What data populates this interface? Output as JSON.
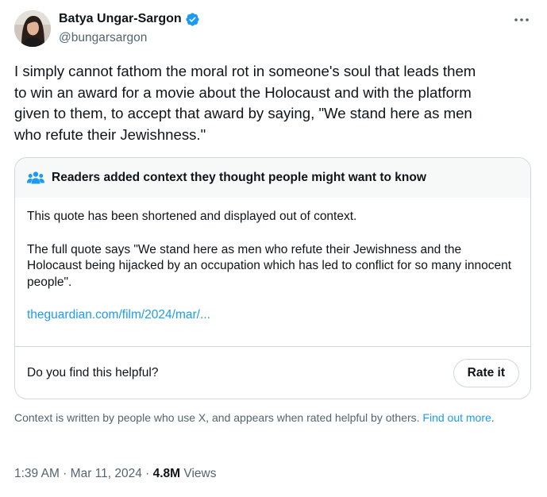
{
  "author": {
    "display_name": "Batya Ungar-Sargon",
    "handle": "@bungarsargon",
    "verified": true
  },
  "tweet": {
    "text": "I simply cannot fathom the moral rot in someone's soul that leads them\nto win an award for a movie about the Holocaust and with the platform\ngiven to them, to accept that award by saying, \"We stand here as men\nwho refute their Jewishness.\""
  },
  "community_note": {
    "title": "Readers added context they thought people might want to know",
    "paragraph_1": "This quote has been shortened and displayed out of context.",
    "paragraph_2": "The full quote says \"We stand here as men who refute their Jewishness and the Holocaust being hijacked by an occupation which has led to conflict for so many innocent people\".",
    "link_text": "theguardian.com/film/2024/mar/...",
    "helpful_question": "Do you find this helpful?",
    "rate_button_label": "Rate it"
  },
  "footnote": {
    "text": "Context is written by people who use X, and appears when rated helpful by others. ",
    "link_text": "Find out more",
    "suffix": "."
  },
  "meta": {
    "time": "1:39 AM",
    "separator": " · ",
    "date": "Mar 11, 2024",
    "views_count": "4.8M",
    "views_label": " Views"
  },
  "colors": {
    "accent": "#1d9bf0",
    "text_primary": "#0f1419",
    "text_secondary": "#536471",
    "border": "#cfd9de",
    "note_header_bg": "#f7f9f9"
  },
  "icons": {
    "more": "more-horizontal-icon",
    "verified": "verified-badge-icon",
    "community_notes": "people-group-icon"
  }
}
